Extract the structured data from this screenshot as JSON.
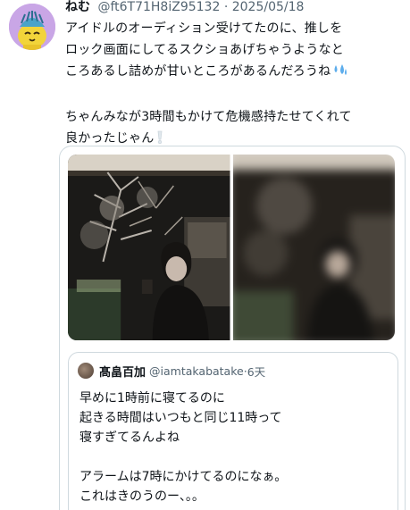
{
  "tweet": {
    "author": {
      "display_name": "ねむ",
      "handle": "@ft6T71H8iZ95132",
      "separator": "·",
      "date": "2025/05/18",
      "avatar_icon": "yellow-character-avatar-icon"
    },
    "text_lines": [
      "アイドルのオーディション受けてたのに、推しを",
      "ロック画面にしてるスクショあげちゃうようなと",
      "ころあるし詰めが甘いところがあるんだろうね"
    ],
    "text_line2": [
      "ちゃんみなが3時間もかけて危機感持たせてくれて",
      "良かったじゃん"
    ],
    "emojis": [
      "sweat-droplets-emoji",
      "white-exclamation-emoji"
    ]
  },
  "quote": {
    "photos": [
      {
        "icon": "photo-person-night-trees",
        "blurred": false
      },
      {
        "icon": "photo-person-night-trees-blurred",
        "blurred": true
      }
    ],
    "embedded": {
      "display_name": "髙畠百加",
      "handle": "@iamtakabatake",
      "separator": "·",
      "time": "6天",
      "lines_a": [
        "早めに1時前に寝てるのに",
        "起きる時間はいつもと同じ11時って",
        "寝すぎてるんよね"
      ],
      "lines_b": [
        "アラームは7時にかけてるのになぁ。",
        "これはきのうのー、。。"
      ]
    }
  },
  "colors": {
    "text": "#0f1419",
    "secondary": "#536471",
    "border": "#cfd9de",
    "avatar_bg": "#c9a6e6"
  }
}
